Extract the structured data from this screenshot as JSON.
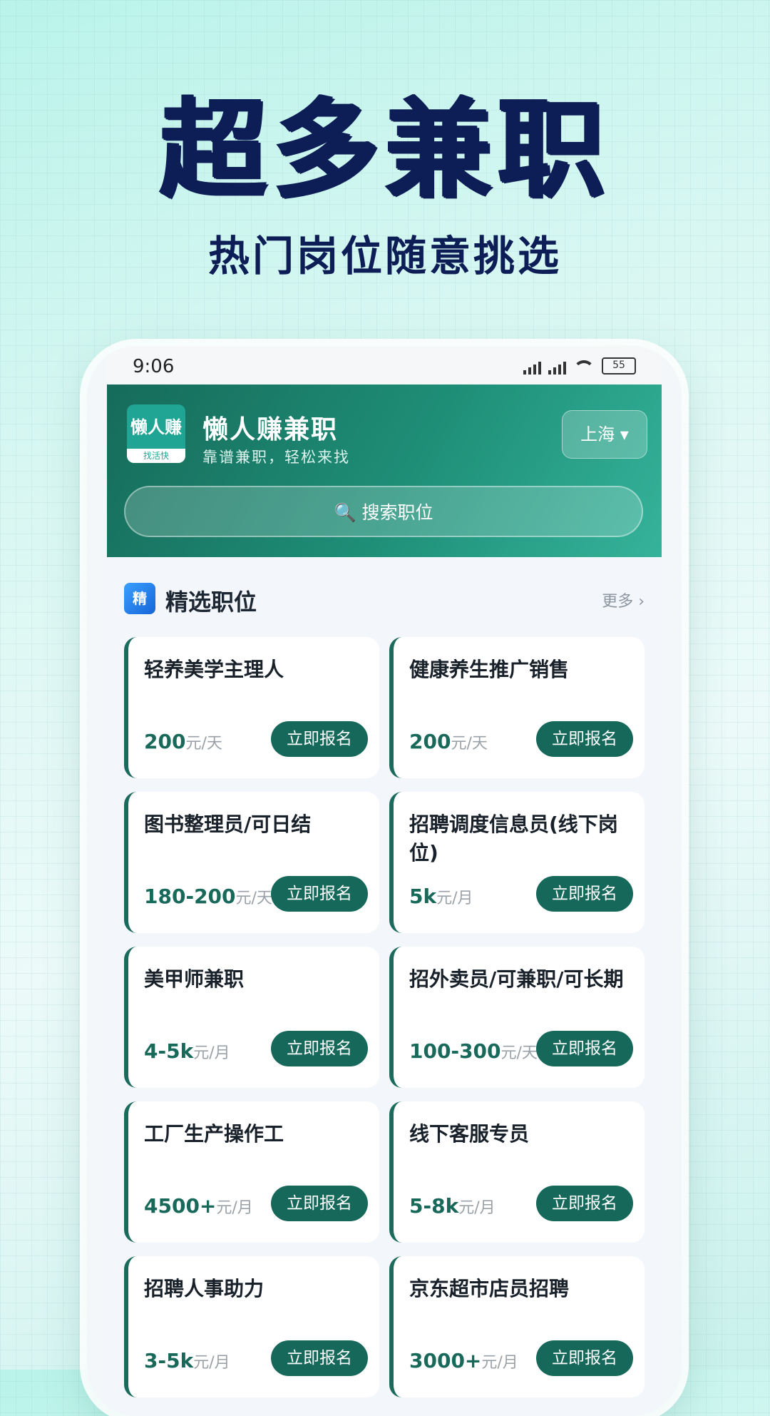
{
  "hero": {
    "title": "超多兼职",
    "subtitle": "热门岗位随意挑选"
  },
  "status_bar": {
    "time": "9:06",
    "battery": "55"
  },
  "header": {
    "logo_text": "懒人赚",
    "logo_subtext": "找活快",
    "app_name": "懒人赚兼职",
    "tagline": "靠谱兼职，轻松来找",
    "city": "上海 ▾",
    "search_placeholder": "🔍 搜索职位"
  },
  "section": {
    "badge": "精",
    "title": "精选职位",
    "more": "更多 ›"
  },
  "jobs": [
    {
      "title": "轻养美学主理人",
      "salary": "200",
      "unit": "元/天",
      "button": "立即报名"
    },
    {
      "title": "健康养生推广销售",
      "salary": "200",
      "unit": "元/天",
      "button": "立即报名"
    },
    {
      "title": "图书整理员/可日结",
      "salary": "180-200",
      "unit": "元/天",
      "button": "立即报名"
    },
    {
      "title": "招聘调度信息员(线下岗位)",
      "salary": "5k",
      "unit": "元/月",
      "button": "立即报名"
    },
    {
      "title": "美甲师兼职",
      "salary": "4-5k",
      "unit": "元/月",
      "button": "立即报名"
    },
    {
      "title": "招外卖员/可兼职/可长期",
      "salary": "100-300",
      "unit": "元/天",
      "button": "立即报名"
    },
    {
      "title": "工厂生产操作工",
      "salary": "4500+",
      "unit": "元/月",
      "button": "立即报名"
    },
    {
      "title": "线下客服专员",
      "salary": "5-8k",
      "unit": "元/月",
      "button": "立即报名"
    },
    {
      "title": "招聘人事助力",
      "salary": "3-5k",
      "unit": "元/月",
      "button": "立即报名"
    },
    {
      "title": "京东超市店员招聘",
      "salary": "3000+",
      "unit": "元/月",
      "button": "立即报名"
    }
  ]
}
